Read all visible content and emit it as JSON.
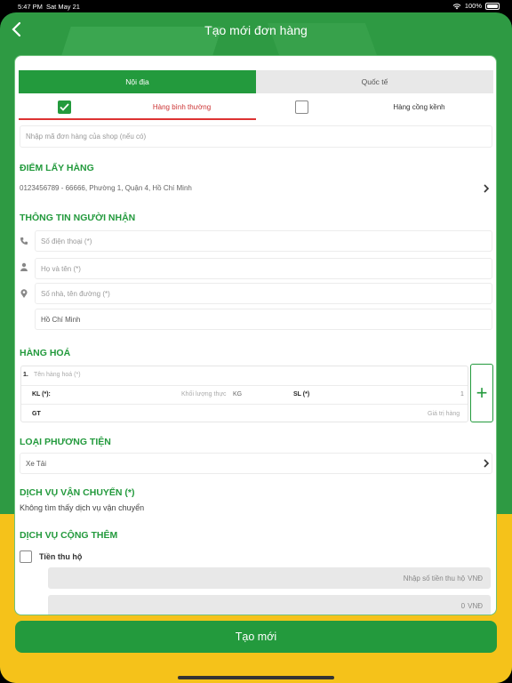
{
  "status_bar": {
    "time": "5:47 PM",
    "date": "Sat May 21",
    "battery": "100%"
  },
  "header": {
    "title": "Tạo mới đơn hàng"
  },
  "tabs": [
    {
      "label": "Nội địa"
    },
    {
      "label": "Quốc tế"
    }
  ],
  "subtabs": [
    {
      "label": "Hàng bình thường",
      "checked": true
    },
    {
      "label": "Hàng cồng kềnh",
      "checked": false
    }
  ],
  "shop_order_code": {
    "placeholder": "Nhập mã đơn hàng của shop (nếu có)"
  },
  "pickup": {
    "title": "ĐIỂM LẤY HÀNG",
    "address": "0123456789 - 66666, Phường 1, Quận 4, Hồ Chí Minh"
  },
  "recipient": {
    "title": "THÔNG TIN NGƯỜI NHẬN",
    "phone_placeholder": "Số điện thoại (*)",
    "name_placeholder": "Họ và tên (*)",
    "address_placeholder": "Số nhà, tên đường (*)",
    "city": "Hồ Chí Minh"
  },
  "goods": {
    "title": "HÀNG HOÁ",
    "index": "1.",
    "name_placeholder": "Tên hàng hoá (*)",
    "weight_label": "KL (*):",
    "weight_placeholder": "Khối lượng thực",
    "weight_unit": "KG",
    "qty_label": "SL (*)",
    "qty_value": "1",
    "value_label": "GT",
    "value_placeholder": "Giá trị hàng",
    "add_symbol": "+"
  },
  "vehicle": {
    "title": "LOẠI PHƯƠNG TIỆN",
    "value": "Xe Tải"
  },
  "shipping_service": {
    "title": "DỊCH VỤ VẬN CHUYỂN (*)",
    "message": "Không tìm thấy dịch vụ vận chuyển"
  },
  "extra_service": {
    "title": "DỊCH VỤ CỘNG THÊM",
    "cod_label": "Tiền thu hộ",
    "cod_placeholder": "Nhập số tiền thu hộ",
    "cod_unit": "VNĐ",
    "second_value": "0",
    "second_unit": "VNĐ"
  },
  "create_button": "Tạo mới",
  "colors": {
    "primary": "#239a3d",
    "accent_red": "#d33333",
    "yellow": "#f5c21a"
  }
}
